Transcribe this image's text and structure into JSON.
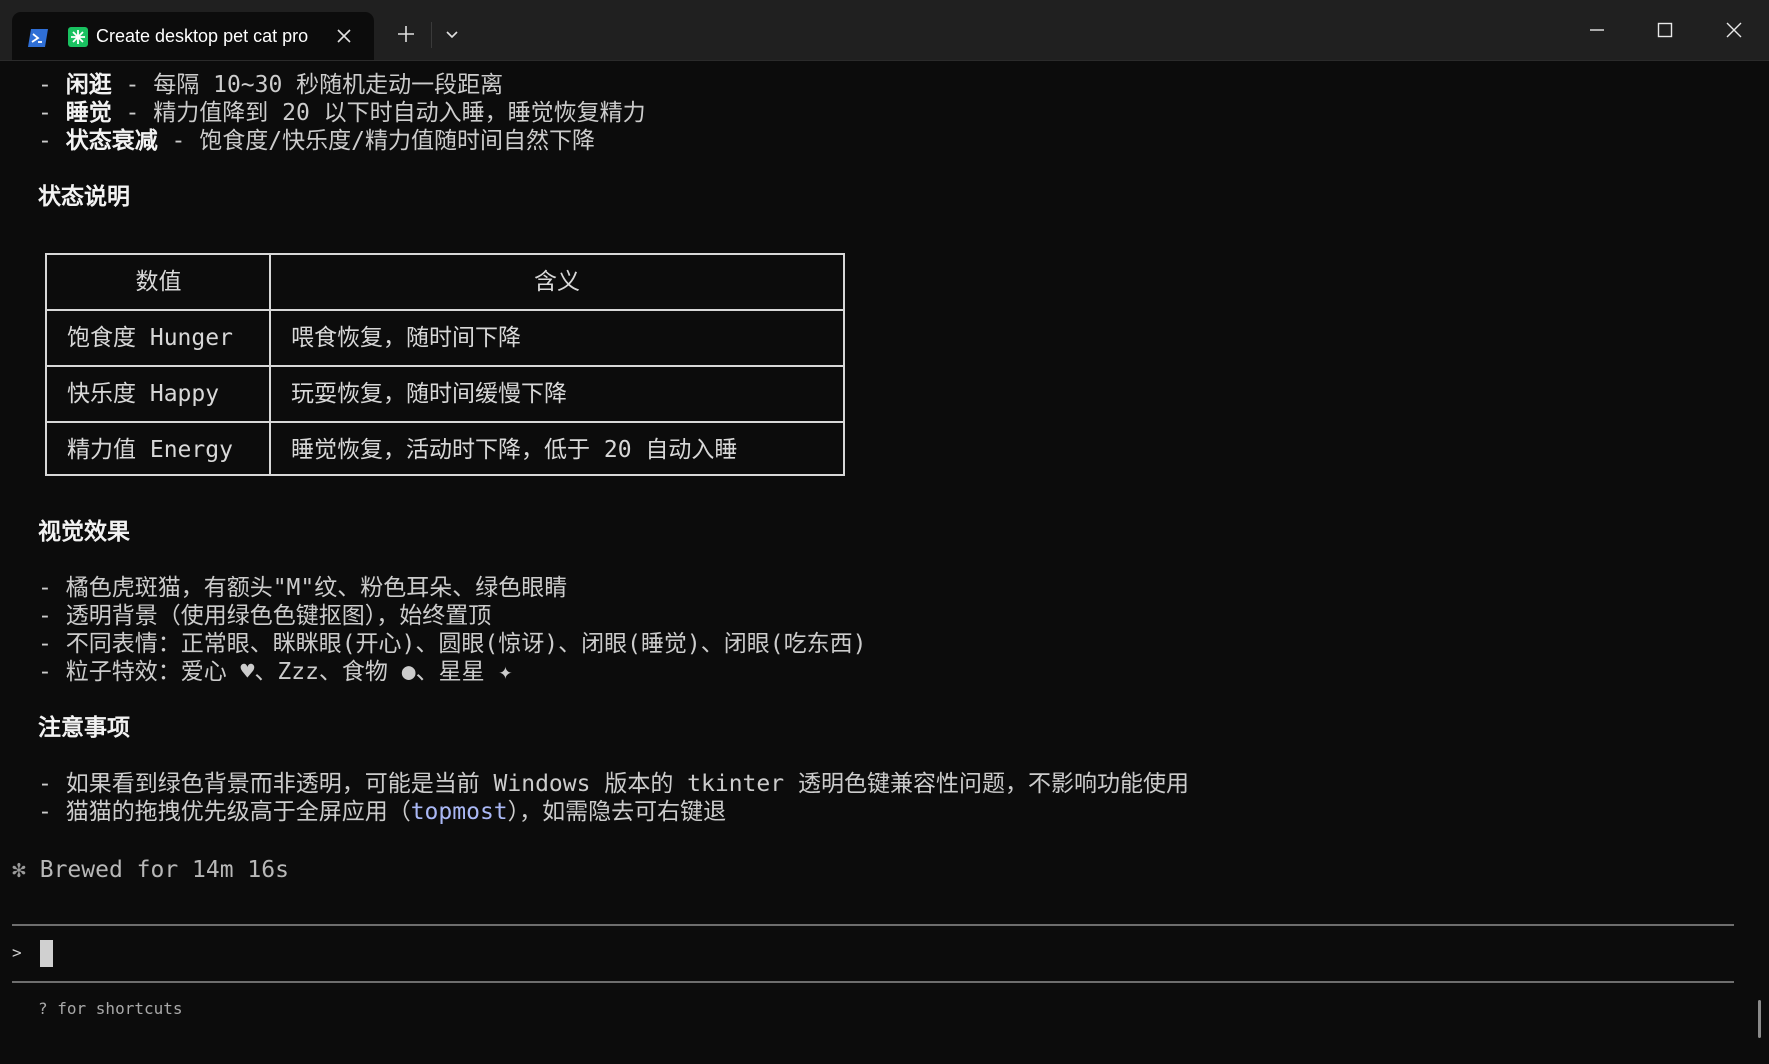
{
  "window": {
    "tab_title": "Create desktop pet cat pro",
    "shell_icon": "powershell-icon",
    "app_icon": "sparkle-icon"
  },
  "colors": {
    "background": "#0c0c0c",
    "titlebar": "#202020",
    "text": "#cccccc",
    "code_highlight": "#aab8f5",
    "app_icon_green": "#19c160"
  },
  "content": {
    "behaviors": [
      {
        "prefix": "- ",
        "term": "闲逛",
        "rest": " - 每隔 10~30 秒随机走动一段距离"
      },
      {
        "prefix": "- ",
        "term": "睡觉",
        "rest": " - 精力值降到 20 以下时自动入睡，睡觉恢复精力"
      },
      {
        "prefix": "- ",
        "term": "状态衰减",
        "rest": " - 饱食度/快乐度/精力值随时间自然下降"
      }
    ],
    "status_heading": "状态说明",
    "table": {
      "headers": [
        "数值",
        "含义"
      ],
      "rows": [
        [
          "饱食度 Hunger",
          "喂食恢复，随时间下降"
        ],
        [
          "快乐度 Happy",
          "玩耍恢复，随时间缓慢下降"
        ],
        [
          "精力值 Energy",
          "睡觉恢复，活动时下降，低于 20 自动入睡"
        ]
      ]
    },
    "visual_heading": "视觉效果",
    "visual_items": [
      "- 橘色虎斑猫，有额头\"M\"纹、粉色耳朵、绿色眼睛",
      "- 透明背景（使用绿色色键抠图），始终置顶",
      "- 不同表情：正常眼、眯眯眼(开心)、圆眼(惊讶)、闭眼(睡觉)、闭眼(吃东西)",
      "- 粒子特效：爱心 ♥、Zzz、食物 ●、星星 ✦"
    ],
    "notes_heading": "注意事项",
    "notes": {
      "item1": "- 如果看到绿色背景而非透明，可能是当前 Windows 版本的 tkinter 透明色键兼容性问题，不影响功能使用",
      "item2_before": "- 猫猫的拖拽优先级高于全屏应用（",
      "item2_code": "topmost",
      "item2_after": "），如需隐去可右键退"
    }
  },
  "status": {
    "star": "✻",
    "brewed": "Brewed for 14m 16s"
  },
  "prompt": {
    "symbol": ">",
    "input_value": "",
    "hint": "? for shortcuts"
  }
}
